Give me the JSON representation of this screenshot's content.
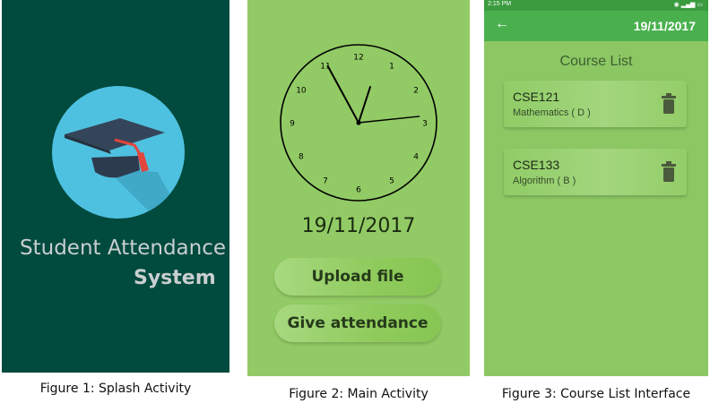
{
  "figure1": {
    "title_line1": "Student Attendance",
    "title_line2": "System",
    "caption": "Figure 1: Splash Activity",
    "colors": {
      "background": "#014a3e",
      "circle": "#4fc1e0"
    },
    "icon": "graduation-cap-icon"
  },
  "figure2": {
    "clock": {
      "numbers": [
        "12",
        "1",
        "2",
        "3",
        "4",
        "5",
        "6",
        "7",
        "8",
        "9",
        "10",
        "11"
      ],
      "hour": 11,
      "minute": 3,
      "second": 14
    },
    "date": "19/11/2017",
    "upload_label": "Upload file",
    "attendance_label": "Give attendance",
    "caption": "Figure 2: Main Activity",
    "colors": {
      "background": "#92cb65"
    }
  },
  "figure3": {
    "status_time": "2:15 PM",
    "appbar_date": "19/11/2017",
    "heading": "Course List",
    "courses": [
      {
        "code": "CSE121",
        "name": "Mathematics ( D )"
      },
      {
        "code": "CSE133",
        "name": "Algorithm ( B )"
      }
    ],
    "caption": "Figure 3: Course List Interface",
    "colors": {
      "background": "#8cc764",
      "appbar": "#49b04d",
      "statusbar": "#3b9b3f"
    }
  }
}
